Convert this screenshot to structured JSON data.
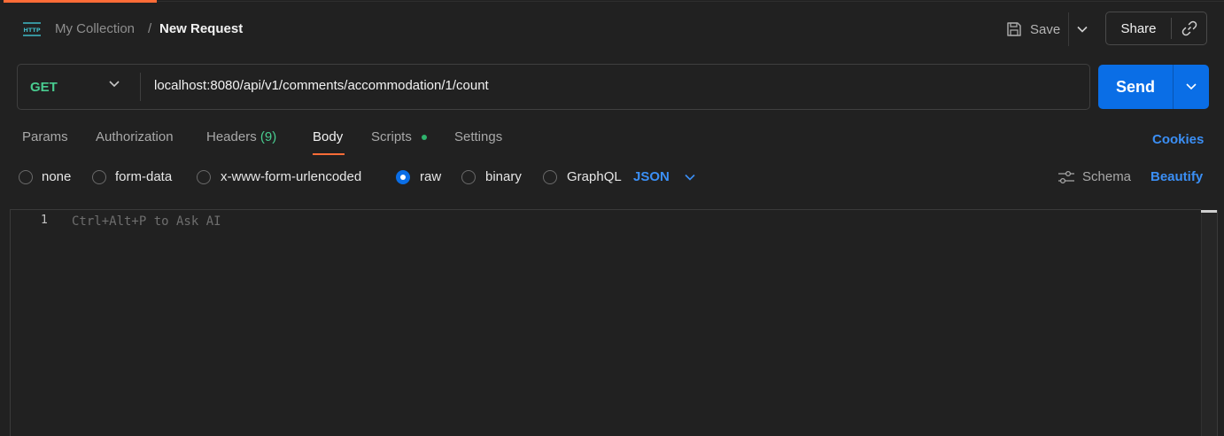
{
  "header": {
    "icon": "http-icon",
    "collection": "My Collection",
    "separator": "/",
    "request_name": "New Request",
    "save_label": "Save",
    "share_label": "Share"
  },
  "request": {
    "method": "GET",
    "url": "localhost:8080/api/v1/comments/accommodation/1/count",
    "send_label": "Send"
  },
  "tabs": {
    "params": "Params",
    "authorization": "Authorization",
    "headers": "Headers",
    "headers_count": "(9)",
    "body": "Body",
    "scripts": "Scripts",
    "settings": "Settings",
    "active": "Body",
    "cookies": "Cookies"
  },
  "body_options": {
    "none": "none",
    "form_data": "form-data",
    "urlencoded": "x-www-form-urlencoded",
    "raw": "raw",
    "binary": "binary",
    "graphql": "GraphQL",
    "selected": "raw",
    "format": "JSON",
    "schema": "Schema",
    "beautify": "Beautify"
  },
  "editor": {
    "line_number": "1",
    "placeholder": "Ctrl+Alt+P to Ask AI"
  },
  "colors": {
    "accent": "#ff6c37",
    "method_get": "#49cc90",
    "primary": "#0a6ee6",
    "link": "#3b8ff5",
    "background": "#212121"
  }
}
